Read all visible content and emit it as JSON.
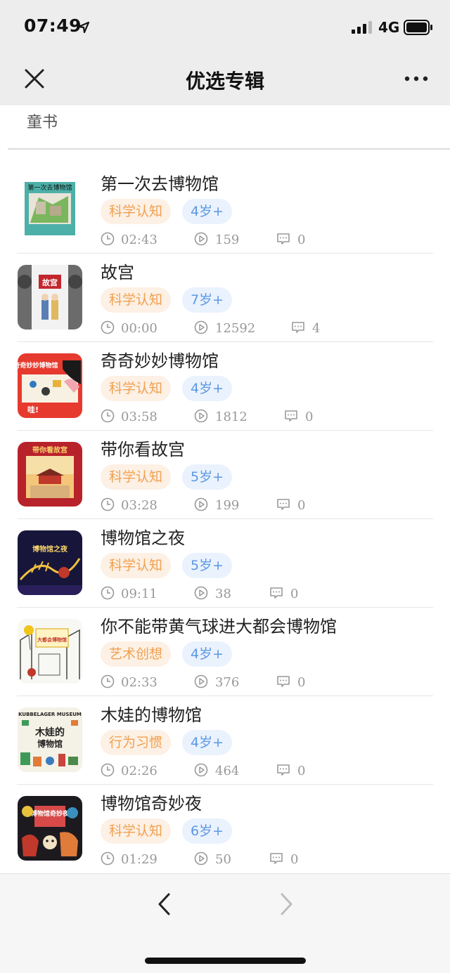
{
  "status_bar": {
    "time": "07:49",
    "network": "4G"
  },
  "header": {
    "title": "优选专辑"
  },
  "category": "童书",
  "items": [
    {
      "title": "第一次去博物馆",
      "category_tag": "科学认知",
      "age_tag": "4岁+",
      "duration": "02:43",
      "plays": "159",
      "comments": "0",
      "cover_title": "第一次去博物馆"
    },
    {
      "title": "故宫",
      "category_tag": "科学认知",
      "age_tag": "7岁+",
      "duration": "00:00",
      "plays": "12592",
      "comments": "4",
      "cover_title": "故宫"
    },
    {
      "title": "奇奇妙妙博物馆",
      "category_tag": "科学认知",
      "age_tag": "4岁+",
      "duration": "03:58",
      "plays": "1812",
      "comments": "0",
      "cover_title": "奇奇妙妙博物馆"
    },
    {
      "title": "带你看故宫",
      "category_tag": "科学认知",
      "age_tag": "5岁+",
      "duration": "03:28",
      "plays": "199",
      "comments": "0",
      "cover_title": "带你看故宫"
    },
    {
      "title": "博物馆之夜",
      "category_tag": "科学认知",
      "age_tag": "5岁+",
      "duration": "09:11",
      "plays": "38",
      "comments": "0",
      "cover_title": "博物馆之夜"
    },
    {
      "title": "你不能带黄气球进大都会博物馆",
      "category_tag": "艺术创想",
      "age_tag": "4岁+",
      "duration": "02:33",
      "plays": "376",
      "comments": "0",
      "cover_title": "大都会博物馆"
    },
    {
      "title": "木娃的博物馆",
      "category_tag": "行为习惯",
      "age_tag": "4岁+",
      "duration": "02:26",
      "plays": "464",
      "comments": "0",
      "cover_title": "KUBBELAGER MUSEUM"
    },
    {
      "title": "博物馆奇妙夜",
      "category_tag": "科学认知",
      "age_tag": "6岁+",
      "duration": "01:29",
      "plays": "50",
      "comments": "0",
      "cover_title": "博物馆奇妙夜"
    }
  ],
  "colors": {
    "tag_category_text": "#f0a050",
    "tag_category_bg": "#fdf0e4",
    "tag_age_text": "#5b97e5",
    "tag_age_bg": "#eaf2fd"
  }
}
